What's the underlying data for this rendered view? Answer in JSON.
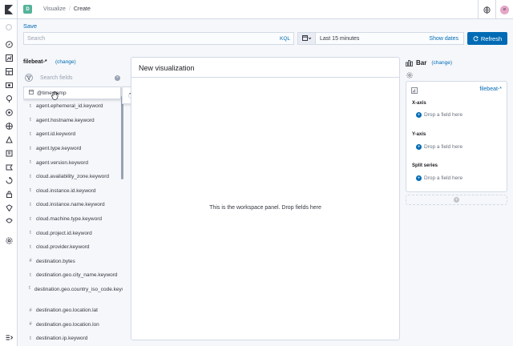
{
  "header": {
    "space_initial": "D",
    "breadcrumbs": [
      "Visualize",
      "Create"
    ],
    "avatar_initial": "e"
  },
  "toolbar": {
    "save_label": "Save"
  },
  "query": {
    "search_placeholder": "Search",
    "language": "KQL",
    "time_range": "Last 15 minutes",
    "show_dates": "Show dates",
    "refresh": "Refresh"
  },
  "fields_panel": {
    "index_pattern": "filebeat-*",
    "change": "(change)",
    "search_placeholder": "Search fields",
    "dragged_field": {
      "type": "calendar-icon",
      "name": "@timestamp"
    },
    "fields": [
      {
        "type": "t",
        "name": "agent.ephemeral_id.keyword"
      },
      {
        "type": "t",
        "name": "agent.hostname.keyword"
      },
      {
        "type": "t",
        "name": "agent.id.keyword"
      },
      {
        "type": "t",
        "name": "agent.type.keyword"
      },
      {
        "type": "t",
        "name": "agent.version.keyword"
      },
      {
        "type": "t",
        "name": "cloud.availability_zone.keyword"
      },
      {
        "type": "t",
        "name": "cloud.instance.id.keyword"
      },
      {
        "type": "t",
        "name": "cloud.instance.name.keyword"
      },
      {
        "type": "t",
        "name": "cloud.machine.type.keyword"
      },
      {
        "type": "t",
        "name": "cloud.project.id.keyword"
      },
      {
        "type": "t",
        "name": "cloud.provider.keyword"
      },
      {
        "type": "#",
        "name": "destination.bytes"
      },
      {
        "type": "t",
        "name": "destination.geo.city_name.keyword"
      },
      {
        "type": "t",
        "name": "destination.geo.country_iso_code.keyword"
      },
      {
        "type": "#",
        "name": "destination.geo.location.lat"
      },
      {
        "type": "#",
        "name": "destination.geo.location.lon"
      },
      {
        "type": "t",
        "name": "destination.ip.keyword"
      }
    ]
  },
  "workspace": {
    "title": "New visualization",
    "empty_message": "This is the workspace panel. Drop fields here"
  },
  "config": {
    "chart_type": "Bar",
    "change": "(change)",
    "layer_index_pattern": "filebeat-*",
    "sections": [
      {
        "label": "X-axis",
        "drop": "Drop a field here"
      },
      {
        "label": "Y-axis",
        "drop": "Drop a field here"
      },
      {
        "label": "Split series",
        "drop": "Drop a field here"
      }
    ]
  },
  "colors": {
    "accent": "#006bb4",
    "space_badge": "#54b399"
  }
}
